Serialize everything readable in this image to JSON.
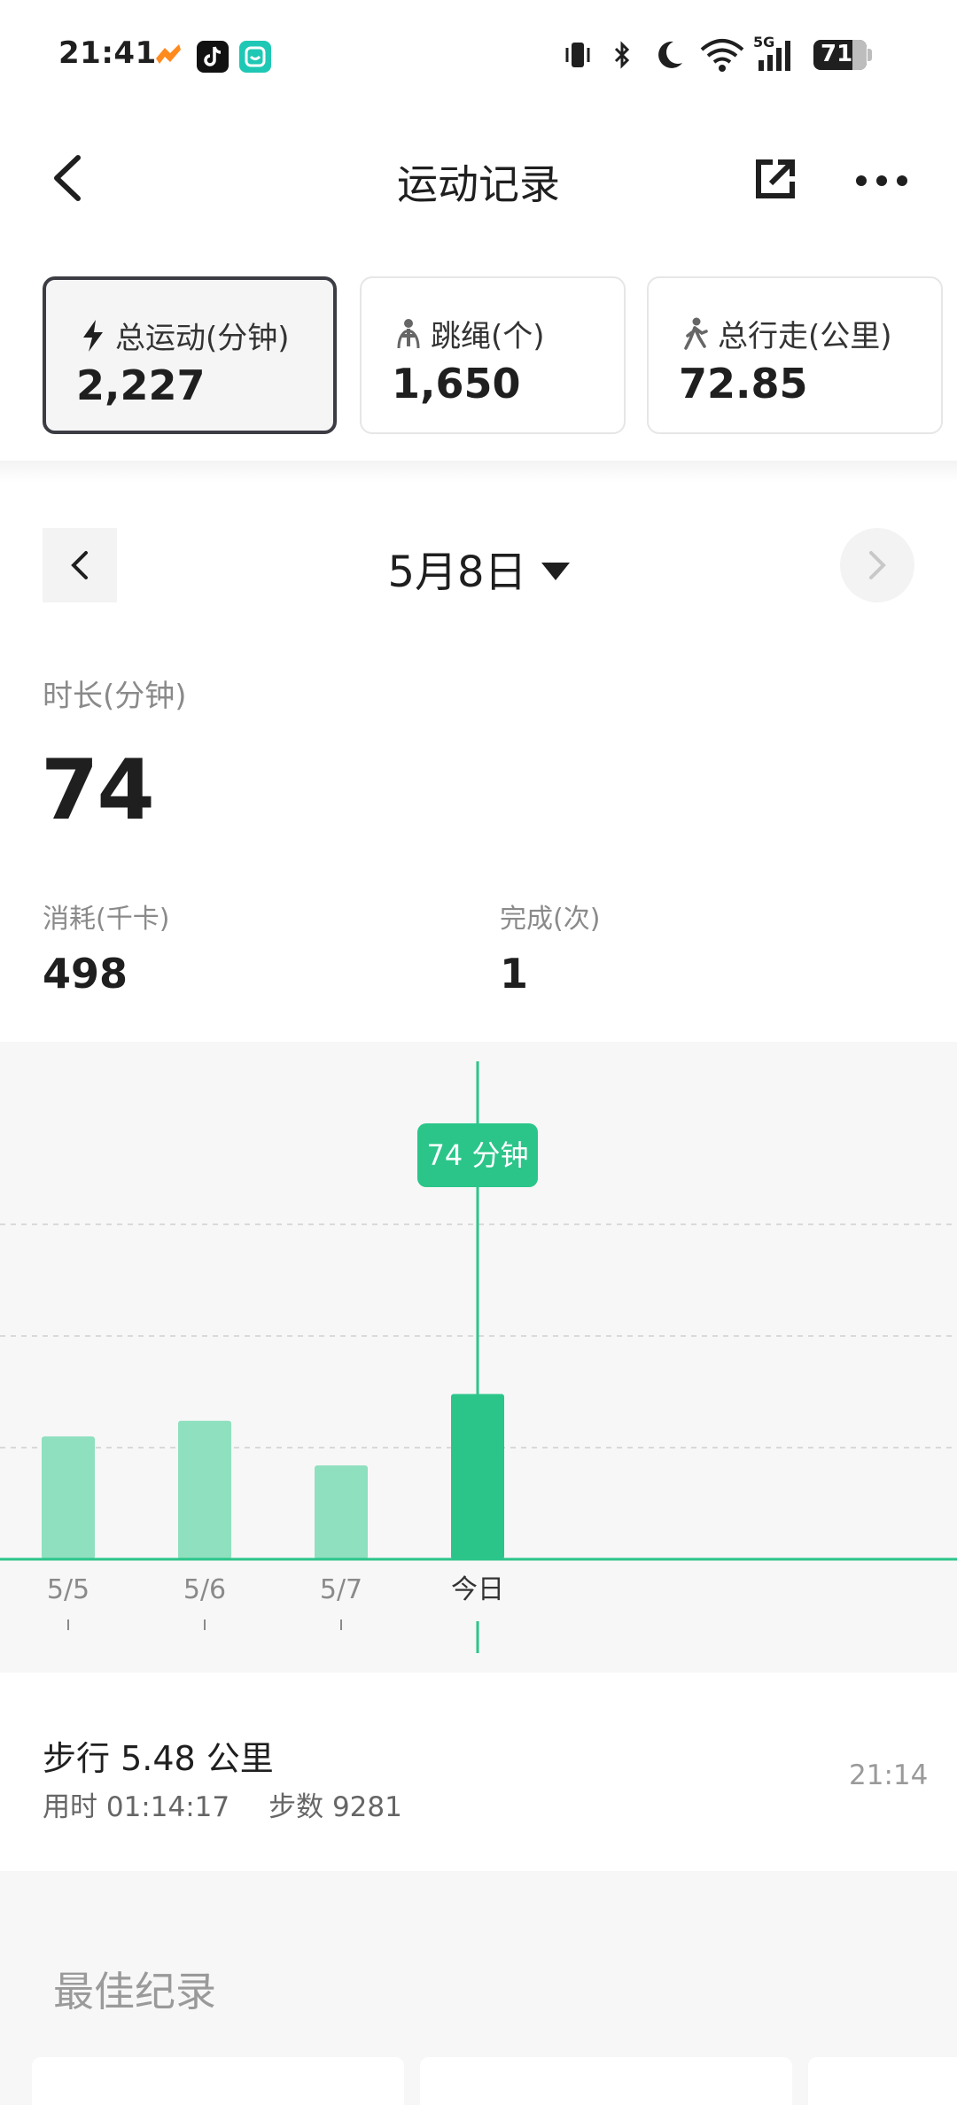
{
  "status_bar": {
    "time": "21:41",
    "network": "5G",
    "battery": "71",
    "icons": [
      "vibrate-icon",
      "bluetooth-icon",
      "moon-icon",
      "wifi-icon",
      "signal-icon",
      "battery-icon"
    ]
  },
  "header": {
    "title": "运动记录"
  },
  "tabs": [
    {
      "label": "总运动(分钟)",
      "value": "2,227",
      "icon": "bolt-icon",
      "active": true
    },
    {
      "label": "跳绳(个)",
      "value": "1,650",
      "icon": "jump-rope-icon",
      "active": false
    },
    {
      "label": "总行走(公里)",
      "value": "72.85",
      "icon": "walk-icon",
      "active": false
    }
  ],
  "date_nav": {
    "label": "5月8日"
  },
  "stats": {
    "duration_label": "时长(分钟)",
    "duration_value": "74",
    "kcal_label": "消耗(千卡)",
    "kcal_value": "498",
    "done_label": "完成(次)",
    "done_value": "1"
  },
  "chart_data": {
    "type": "bar",
    "categories": [
      "5/5",
      "5/6",
      "5/7",
      "今日"
    ],
    "values": [
      55,
      62,
      42,
      74
    ],
    "selected_index": 3,
    "tooltip": "74 分钟",
    "bar_color": "#8ee0bf",
    "selected_color": "#2bc58a",
    "ylim": [
      0,
      200
    ],
    "grid": true
  },
  "activity": {
    "title": "步行 5.48 公里",
    "duration": "用时 01:14:17",
    "steps": "步数 9281",
    "time": "21:14"
  },
  "best": {
    "title": "最佳纪录"
  },
  "colors": {
    "accent": "#2bc58a",
    "active_tab_border": "#3c3c44"
  }
}
